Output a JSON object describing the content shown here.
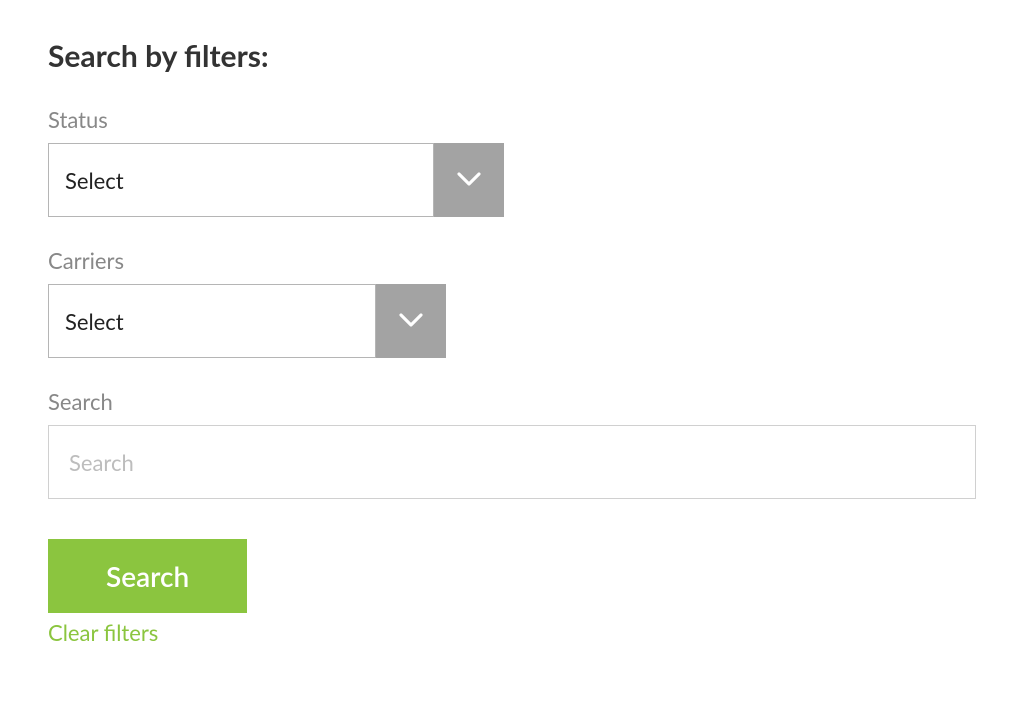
{
  "title": "Search by filters:",
  "filters": {
    "status": {
      "label": "Status",
      "selected": "Select"
    },
    "carriers": {
      "label": "Carriers",
      "selected": "Select"
    },
    "search": {
      "label": "Search",
      "placeholder": "Search",
      "value": ""
    }
  },
  "actions": {
    "search_label": "Search",
    "clear_label": "Clear filters"
  },
  "colors": {
    "accent": "#8bc53f",
    "muted_text": "#888888",
    "border": "#b5b5b5",
    "dropdown_toggle": "#a3a3a3"
  }
}
